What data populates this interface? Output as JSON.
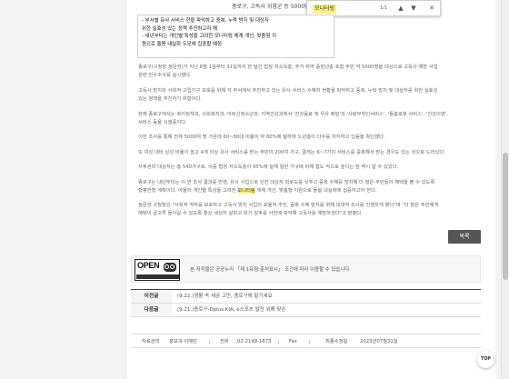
{
  "header": {
    "title_fragment": "종로구, 고독사 위험군 등 5000명"
  },
  "find_bar": {
    "query": "모니터링",
    "count": "1/1",
    "up_glyph": "▲",
    "down_glyph": "▼",
    "close_glyph": "✕"
  },
  "summary_box": {
    "lines": [
      "- 부서별 유사 서비스 현황 파악하고 중복, 누락 방지 및 대상자",
      "  위한 실효성 있는 정책 추진하고자 해",
      "- 내년부터는 개인별 특성을 고려한 모니터링 체계 개선, 맞춤형 지",
      "  원으로 돌봄 내실화 도모에 집중할 예정"
    ]
  },
  "article": {
    "p1_l1": "종로구(구청장 정문헌)가 지난 8월 1일부터 31일까지 한 달간 법정 저소득층, 주거 취약 중장년층 포함 주민 약 5000명을 대상으로 고독사 예방 사업",
    "p1_l2": "관련 전수조사를 실시했다.",
    "p2_l1": "고독사 방지와 사회적 고립가구 보호를 위해 각 부서에서 추진하고 있는 유사 서비스 수혜자 현황을 파악하고 중복, 누락 방지 및 대상자를 위한 실효성",
    "p2_l2": "있는 정책을 추진하기 위함이다.",
    "p3_l1": "현재 종로구에서는 복지정책과, 사회복지과, 어르신청소년과, 지역건강과에서 '건강음료 및 우유 배달'과 '사랑부착인서비스', '돌봄로봇 서비스', '건강이영',",
    "p3_l2": "서비스 등을 시행중이다.",
    "p4": "이번 조사를 통해 전체 5000여 명 가운데 60~80대 비율이 약 80%에 달하며 노년층이 다수를 차지하고 있음을 확인했다.",
    "p5": "또 여성 대비 남성 비율이 높고 4개 이상 유사 서비스를 받는 주민이 200여 가구, 결게는 6~7가지 서비스를 중복해서 받는 경우도 있는 것으로 드러났다.",
    "p6": "사후관리 대상자는 총 540가구로, 이중 법정 저소득층이 95%에 달해 일반 가구에 비해 접도 적으로 높다는 점 역시 알 수 있었다.",
    "p7_l1": "종로구는 내년부터는 이 번 조사 결과를 반영, 유사 사업으로 인한 대상자 피로도를 낮추고 중복 수혜를 방지해 더 많은 주민들이 혜택을 볼 수 있도록",
    "p7_l2_a": "형평한형 계획이다. 아울러 개인별 특성을 고려한 ",
    "p7_l2_mark": "모니터링",
    "p7_l2_b": " 체계 개선, 맞춤형 지원으로 돌봄 내실화에 집중하고자 한다.",
    "p8_l1": "정문헌 구청장은 \"사회적 약자를 보호하고 고독사 방지 사업의 효율적 추진, 중복 수혜 방지를 위해 대대적 조사를 진행하게 됐다\"며 \"더 많은 주민에게",
    "p8_l2": "혜택이 골고루 돌아갈 수 있도록 항상 세심히 살피고 위기 징후를 사전에 파악해 고독사를 예방하겠다\"고 밝혔다."
  },
  "list_button": "목록",
  "license": {
    "logo_text": "OPEN",
    "text": "본 저작물은 공공누리 「제 1유형:출처표시」 조건에 따라 이용할 수 있습니다."
  },
  "nav": [
    {
      "label": "이전글",
      "title": "(9.22.)생활 속 세금 고민, 종로구에 맡기세요"
    },
    {
      "label": "다음글",
      "title": "(9.21.)종로구-Dplus KIA, e스포츠 발전 위해 맞손"
    }
  ],
  "footer_info": {
    "dept_label": "자료관리",
    "dept": "홍보과 이혜민",
    "phone_label": "전화",
    "phone": "02-2148-1675",
    "fax_label": "Fax",
    "updated_label": "최종수정일",
    "updated": "2023년07월31일"
  },
  "top_button": "TOP"
}
